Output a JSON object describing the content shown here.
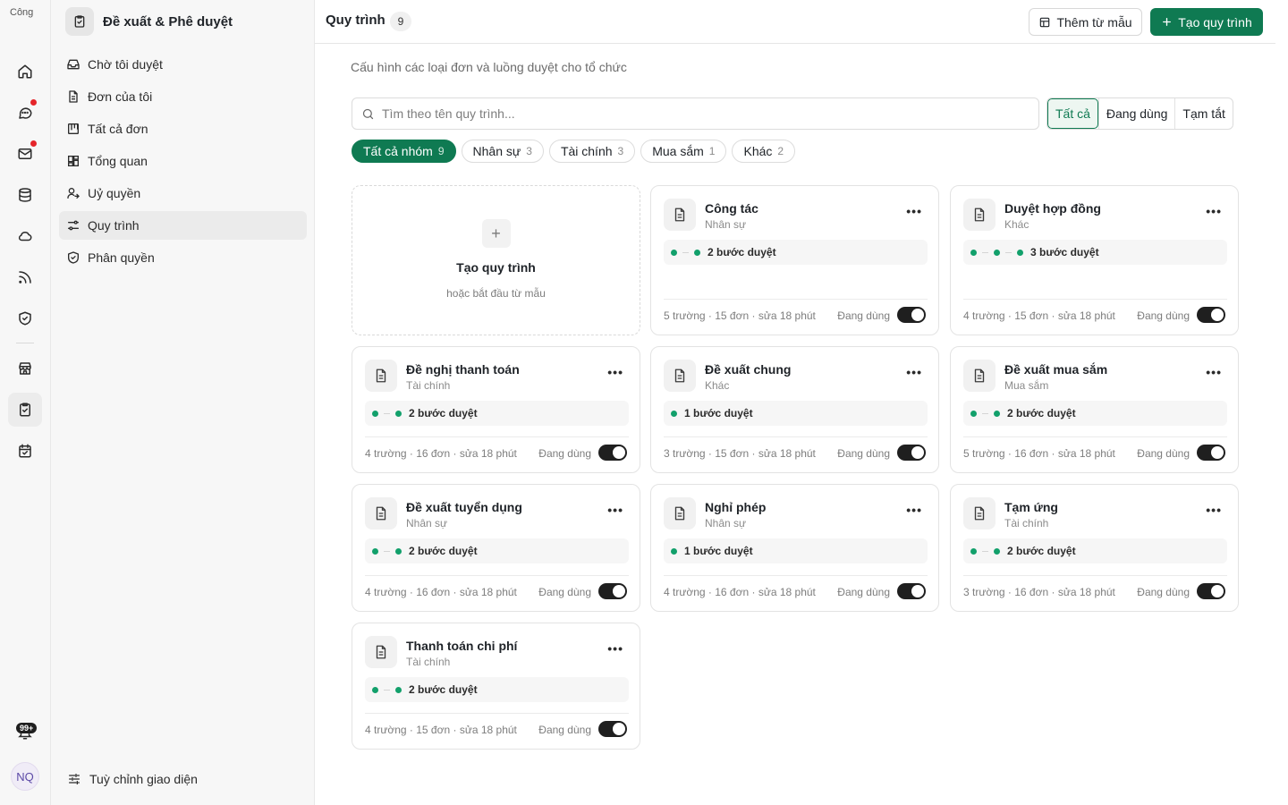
{
  "rail": {
    "logo_alt": "Công",
    "notification_count": "99+",
    "avatar_initials": "NQ"
  },
  "sidebar": {
    "title": "Đề xuất & Phê duyệt",
    "items": [
      {
        "label": "Chờ tôi duyệt",
        "icon": "inbox-icon"
      },
      {
        "label": "Đơn của tôi",
        "icon": "document-icon"
      },
      {
        "label": "Tất cả đơn",
        "icon": "columns-icon"
      },
      {
        "label": "Tổng quan",
        "icon": "dashboard-icon"
      },
      {
        "label": "Uỷ quyền",
        "icon": "user-delegate-icon"
      },
      {
        "label": "Quy trình",
        "icon": "workflow-icon"
      },
      {
        "label": "Phân quyền",
        "icon": "shield-icon"
      }
    ],
    "active_item": "Quy trình",
    "footer_label": "Tuỳ chỉnh giao diện"
  },
  "header": {
    "title": "Quy trình",
    "count": "9",
    "template_button": "Thêm từ mẫu",
    "create_button": "Tạo quy trình"
  },
  "description": "Cấu hình các loại đơn và luồng duyệt cho tổ chức",
  "search": {
    "placeholder": "Tìm theo tên quy trình..."
  },
  "status_filter": [
    "Tất cả",
    "Đang dùng",
    "Tạm tắt"
  ],
  "group_filter": [
    {
      "label": "Tất cả nhóm",
      "count": "9"
    },
    {
      "label": "Nhân sự",
      "count": "3"
    },
    {
      "label": "Tài chính",
      "count": "3"
    },
    {
      "label": "Mua sắm",
      "count": "1"
    },
    {
      "label": "Khác",
      "count": "2"
    }
  ],
  "new_card": {
    "title": "Tạo quy trình",
    "subtitle": "hoặc bắt đầu từ mẫu"
  },
  "cards": [
    {
      "name": "Công tác",
      "group": "Nhân sự",
      "steps": 2,
      "steps_label": "2 bước duyệt",
      "meta": "5 trường · 15 đơn · sửa 18 phút",
      "status": "Đang dùng",
      "enabled": true
    },
    {
      "name": "Duyệt hợp đồng",
      "group": "Khác",
      "steps": 3,
      "steps_label": "3 bước duyệt",
      "meta": "4 trường · 15 đơn · sửa 18 phút",
      "status": "Đang dùng",
      "enabled": true
    },
    {
      "name": "Đề nghị thanh toán",
      "group": "Tài chính",
      "steps": 2,
      "steps_label": "2 bước duyệt",
      "meta": "4 trường · 16 đơn · sửa 18 phút",
      "status": "Đang dùng",
      "enabled": true
    },
    {
      "name": "Đề xuất chung",
      "group": "Khác",
      "steps": 1,
      "steps_label": "1 bước duyệt",
      "meta": "3 trường · 15 đơn · sửa 18 phút",
      "status": "Đang dùng",
      "enabled": true
    },
    {
      "name": "Đề xuất mua sắm",
      "group": "Mua sắm",
      "steps": 2,
      "steps_label": "2 bước duyệt",
      "meta": "5 trường · 16 đơn · sửa 18 phút",
      "status": "Đang dùng",
      "enabled": true
    },
    {
      "name": "Đề xuất tuyển dụng",
      "group": "Nhân sự",
      "steps": 2,
      "steps_label": "2 bước duyệt",
      "meta": "4 trường · 16 đơn · sửa 18 phút",
      "status": "Đang dùng",
      "enabled": true
    },
    {
      "name": "Nghỉ phép",
      "group": "Nhân sự",
      "steps": 1,
      "steps_label": "1 bước duyệt",
      "meta": "4 trường · 16 đơn · sửa 18 phút",
      "status": "Đang dùng",
      "enabled": true
    },
    {
      "name": "Tạm ứng",
      "group": "Tài chính",
      "steps": 2,
      "steps_label": "2 bước duyệt",
      "meta": "3 trường · 16 đơn · sửa 18 phút",
      "status": "Đang dùng",
      "enabled": true
    },
    {
      "name": "Thanh toán chi phí",
      "group": "Tài chính",
      "steps": 2,
      "steps_label": "2 bước duyệt",
      "meta": "4 trường · 15 đơn · sửa 18 phút",
      "status": "Đang dùng",
      "enabled": true
    }
  ],
  "colors": {
    "accent": "#0f7a52",
    "step_dot": "#12a06b",
    "notification_dot": "#e5252a"
  }
}
